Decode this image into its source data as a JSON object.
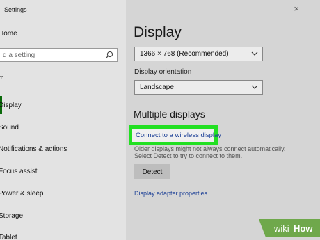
{
  "window": {
    "title": "Settings",
    "close_glyph": "×"
  },
  "sidebar": {
    "home_label": "Home",
    "search_placeholder": "d a setting",
    "section_label": "m",
    "items": [
      {
        "label": "Display",
        "active": true
      },
      {
        "label": "Sound"
      },
      {
        "label": "Notifications & actions"
      },
      {
        "label": "Focus assist"
      },
      {
        "label": "Power & sleep"
      },
      {
        "label": "Storage"
      },
      {
        "label": "Tablet"
      }
    ]
  },
  "main": {
    "title": "Display",
    "resolution_value": "1366 × 768 (Recommended)",
    "orientation_label": "Display orientation",
    "orientation_value": "Landscape",
    "multiple_displays_heading": "Multiple displays",
    "connect_link": "Connect to a wireless display",
    "desc_line1": "Older displays might not always connect automatically.",
    "desc_line2": "Select Detect to try to connect to them.",
    "detect_button": "Detect",
    "adapter_link": "Display adapter properties"
  },
  "watermark": {
    "text1": "wiki",
    "text2": "How"
  },
  "colors": {
    "highlight": "#22e022",
    "link": "#1b3f96",
    "accent": "#0b6a0b"
  },
  "icons": [
    "search-icon",
    "chevron-down-icon",
    "close-icon"
  ]
}
